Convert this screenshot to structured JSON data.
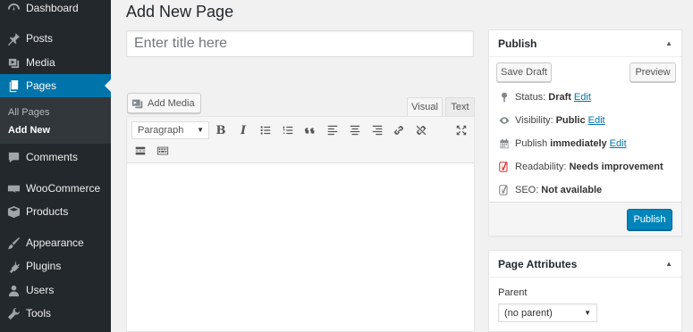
{
  "sidebar": {
    "items": [
      {
        "label": "Dashboard",
        "icon": "dashboard-icon"
      },
      {
        "label": "Posts",
        "icon": "pin-icon"
      },
      {
        "label": "Media",
        "icon": "media-icon"
      },
      {
        "label": "Pages",
        "icon": "pages-icon"
      },
      {
        "label": "Comments",
        "icon": "comment-icon"
      },
      {
        "label": "WooCommerce",
        "icon": "woocommerce-icon"
      },
      {
        "label": "Products",
        "icon": "box-icon"
      },
      {
        "label": "Appearance",
        "icon": "brush-icon"
      },
      {
        "label": "Plugins",
        "icon": "plug-icon"
      },
      {
        "label": "Users",
        "icon": "user-icon"
      },
      {
        "label": "Tools",
        "icon": "wrench-icon"
      }
    ],
    "submenu": [
      "All Pages",
      "Add New"
    ],
    "accent": "#0073aa"
  },
  "main": {
    "title": "Add New Page",
    "title_placeholder": "Enter title here",
    "add_media": "Add Media",
    "tabs": {
      "visual": "Visual",
      "text": "Text"
    },
    "format": "Paragraph"
  },
  "publish": {
    "heading": "Publish",
    "save_draft": "Save Draft",
    "preview": "Preview",
    "status_label": "Status:",
    "status_value": "Draft",
    "visibility_label": "Visibility:",
    "visibility_value": "Public",
    "publish_label": "Publish",
    "publish_value": "immediately",
    "readability_label": "Readability:",
    "readability_value": "Needs improvement",
    "seo_label": "SEO:",
    "seo_value": "Not available",
    "edit": "Edit",
    "button": "Publish",
    "button_color": "#0085ba"
  },
  "attributes": {
    "heading": "Page Attributes",
    "parent_label": "Parent",
    "parent_value": "(no parent)"
  }
}
